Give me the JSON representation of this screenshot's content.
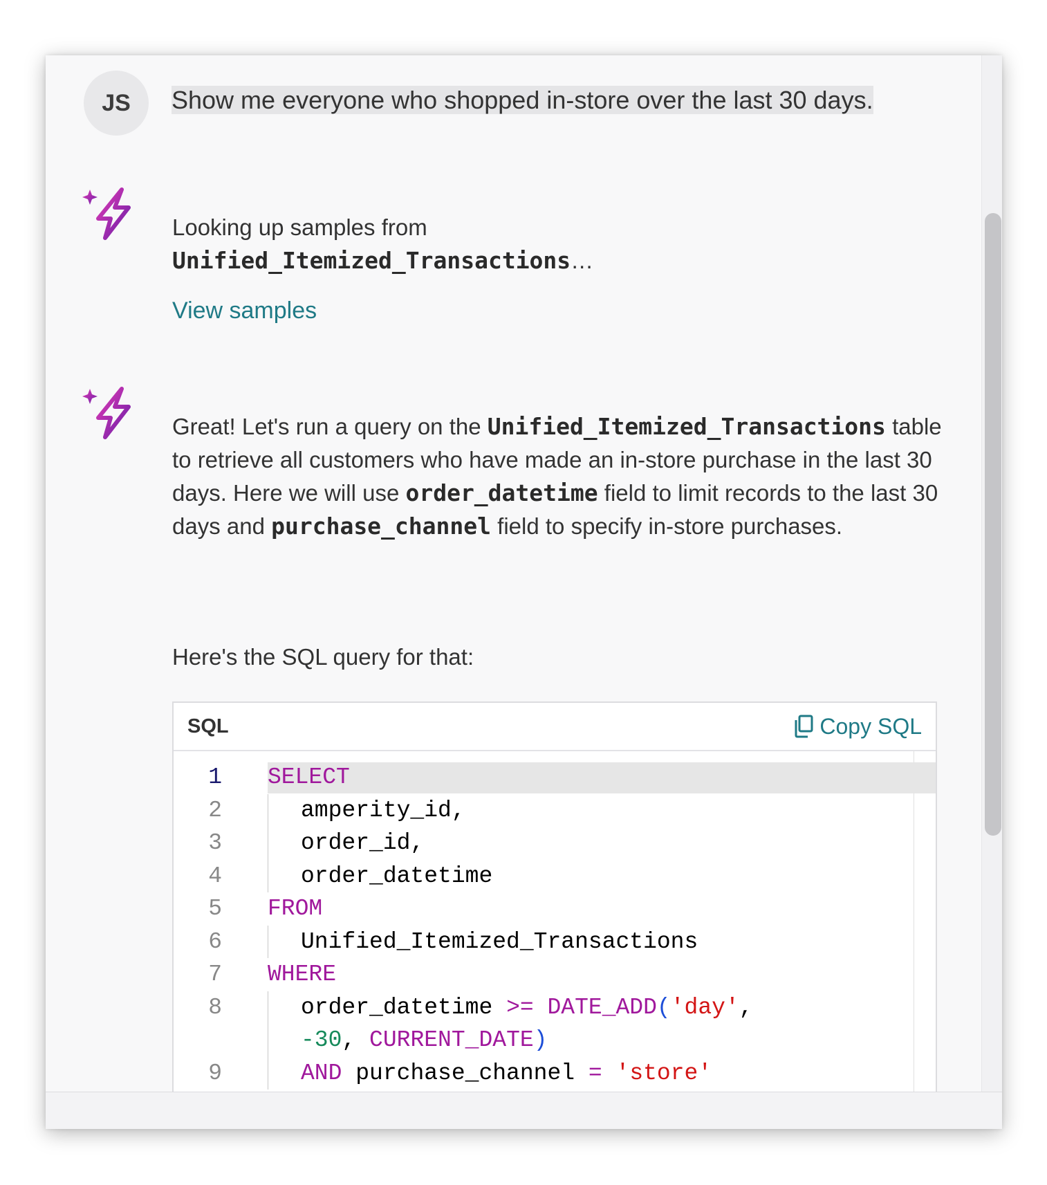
{
  "user": {
    "avatar_initials": "JS",
    "message": "Show me everyone who shopped in-store over the last 30 days."
  },
  "assistant": {
    "msg1": {
      "prefix": "Looking up samples from",
      "table": "Unified_Itemized_Transactions",
      "suffix": "…",
      "link": "View samples"
    },
    "msg2": {
      "part1": "Great! Let's run a query on the ",
      "table": "Unified_Itemized_Transactions",
      "part2": " table to retrieve all customers who have made an in-store purchase in the last 30 days. Here we will use ",
      "field1": "order_datetime",
      "part3": " field to limit records to the last 30 days and ",
      "field2": "purchase_channel",
      "part4": " field to specify in-store purchases."
    },
    "msg3": "Here's the SQL query for that:"
  },
  "code_block": {
    "language": "SQL",
    "copy_label": "Copy SQL",
    "line_numbers": [
      "1",
      "2",
      "3",
      "4",
      "5",
      "6",
      "7",
      "8",
      "9"
    ],
    "lines": {
      "l1": "SELECT",
      "l2": "amperity_id,",
      "l3": "order_id,",
      "l4": "order_datetime",
      "l5": "FROM",
      "l6": "Unified_Itemized_Transactions",
      "l7": "WHERE",
      "l8a": "order_datetime ",
      "l8b": ">=",
      "l8c": " ",
      "l8d": "DATE_ADD",
      "l8e": "(",
      "l8f": "'day'",
      "l8g": ",",
      "l8h": "-30",
      "l8i": ", ",
      "l8j": "CURRENT_DATE",
      "l8k": ")",
      "l9a": "AND",
      "l9b": " purchase_channel ",
      "l9c": "=",
      "l9d": " ",
      "l9e": "'store'"
    }
  },
  "colors": {
    "link": "#1f7a86",
    "keyword": "#a0189c",
    "string": "#d31515",
    "number": "#168a5b",
    "paren": "#1d4ed8"
  },
  "icons": {
    "assistant": "sparkle-bolt-icon",
    "copy": "copy-icon"
  }
}
